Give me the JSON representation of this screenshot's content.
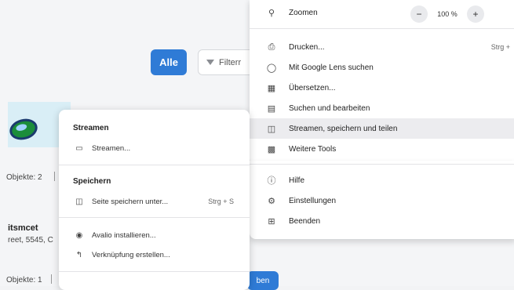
{
  "background": {
    "alle_button": "Alle",
    "filter_button": "Filterr",
    "objects_label_1": "Objekte: 2",
    "card2_title": "itsmcet",
    "card2_subtitle": "reet, 5545, C",
    "objects_label_2": "Objekte: 1",
    "action_button": "ben"
  },
  "main_menu": {
    "zoom": {
      "label": "Zoomen",
      "value": "100 %",
      "minus": "−",
      "plus": "+"
    },
    "items": [
      {
        "label": "Drucken...",
        "shortcut": "Strg +",
        "icon": "printer-icon"
      },
      {
        "label": "Mit Google Lens suchen",
        "icon": "google-lens-icon"
      },
      {
        "label": "Übersetzen...",
        "icon": "translate-icon"
      },
      {
        "label": "Suchen und bearbeiten",
        "icon": "search-edit-icon"
      },
      {
        "label": "Streamen, speichern und teilen",
        "icon": "share-icon"
      },
      {
        "label": "Weitere Tools",
        "icon": "toolbox-icon"
      },
      {
        "label": "Hilfe",
        "icon": "help-icon"
      },
      {
        "label": "Einstellungen",
        "icon": "gear-icon"
      },
      {
        "label": "Beenden",
        "icon": "exit-icon"
      }
    ]
  },
  "sub_menu": {
    "stream_heading": "Streamen",
    "stream_item": "Streamen...",
    "save_heading": "Speichern",
    "save_page": "Seite speichern unter...",
    "save_shortcut": "Strg + S",
    "install": "Avalio installieren...",
    "shortcut_create": "Verknüpfung erstellen..."
  }
}
